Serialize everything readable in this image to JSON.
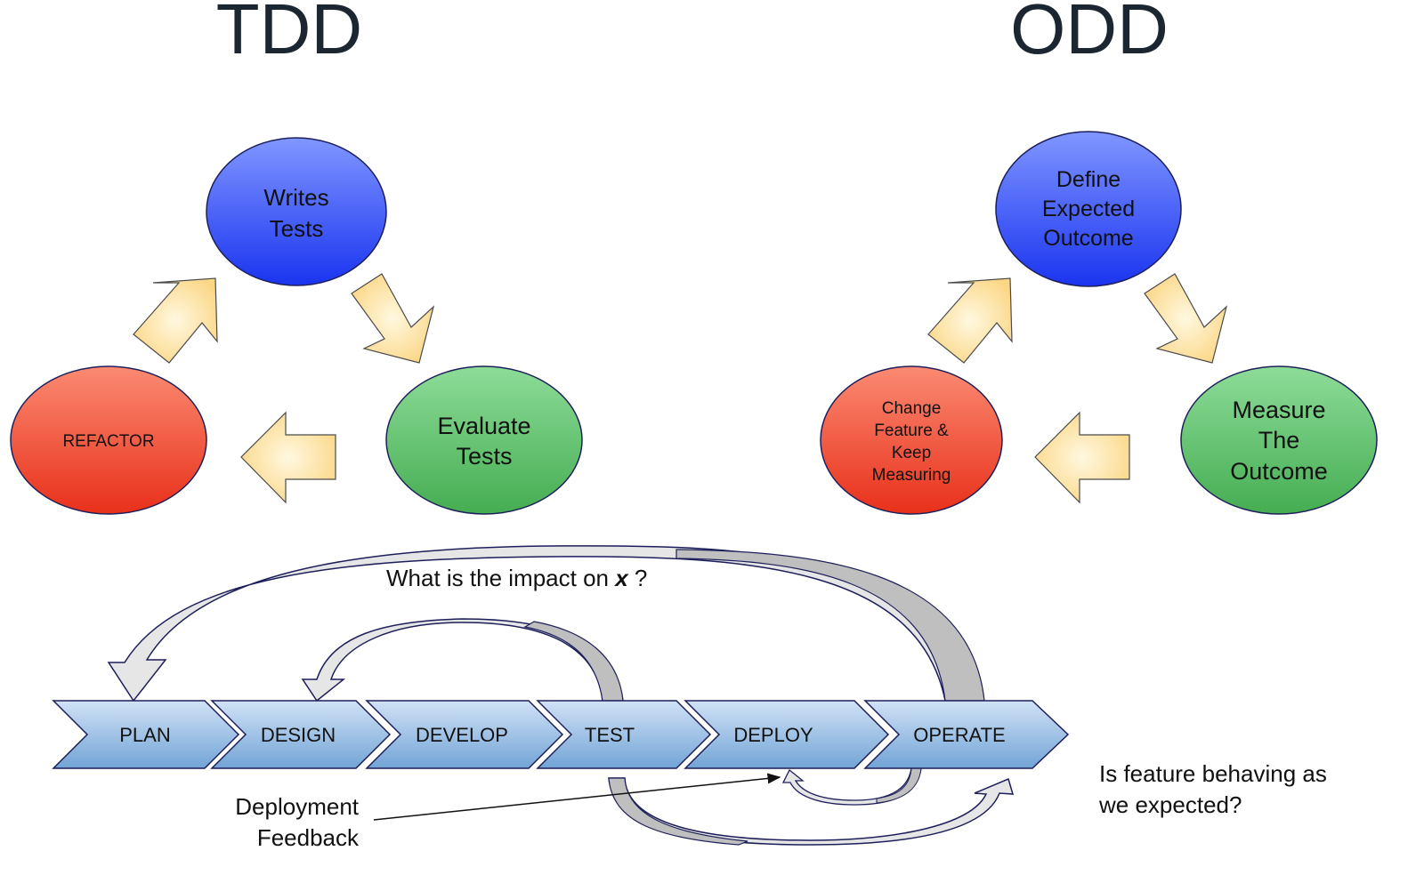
{
  "tdd": {
    "title": "TDD",
    "nodes": [
      {
        "id": "writes-tests",
        "lines": [
          "Writes",
          "Tests"
        ],
        "color": "blue"
      },
      {
        "id": "evaluate-tests",
        "lines": [
          "Evaluate",
          "Tests"
        ],
        "color": "green"
      },
      {
        "id": "refactor",
        "lines": [
          "REFACTOR"
        ],
        "color": "red"
      }
    ]
  },
  "odd": {
    "title": "ODD",
    "nodes": [
      {
        "id": "define-expected-outcome",
        "lines": [
          "Define",
          "Expected",
          "Outcome"
        ],
        "color": "blue"
      },
      {
        "id": "measure-the-outcome",
        "lines": [
          "Measure",
          "The",
          "Outcome"
        ],
        "color": "green"
      },
      {
        "id": "change-feature",
        "lines": [
          "Change",
          "Feature &",
          "Keep",
          "Measuring"
        ],
        "color": "red"
      }
    ]
  },
  "pipeline": {
    "steps": [
      "PLAN",
      "DESIGN",
      "DEVELOP",
      "TEST",
      "DEPLOY",
      "OPERATE"
    ],
    "impact_question_prefix": "What is the impact on ",
    "impact_variable": "x",
    "impact_question_suffix": " ?",
    "deployment_feedback": [
      "Deployment",
      "Feedback"
    ],
    "behaving_question": [
      "Is feature behaving as",
      "we expected?"
    ]
  },
  "colors": {
    "blue_top": "#8096ff",
    "blue_bottom": "#1a34f0",
    "green_top": "#8ddc98",
    "green_bottom": "#45ad52",
    "red_top": "#fb8a72",
    "red_bottom": "#e8301a",
    "arrow_fill": "#fbdc8e",
    "arrow_center": "#fff8e0",
    "step_top": "#d0e2f6",
    "step_bottom": "#72a4d6",
    "outline": "#1d1f5a"
  }
}
